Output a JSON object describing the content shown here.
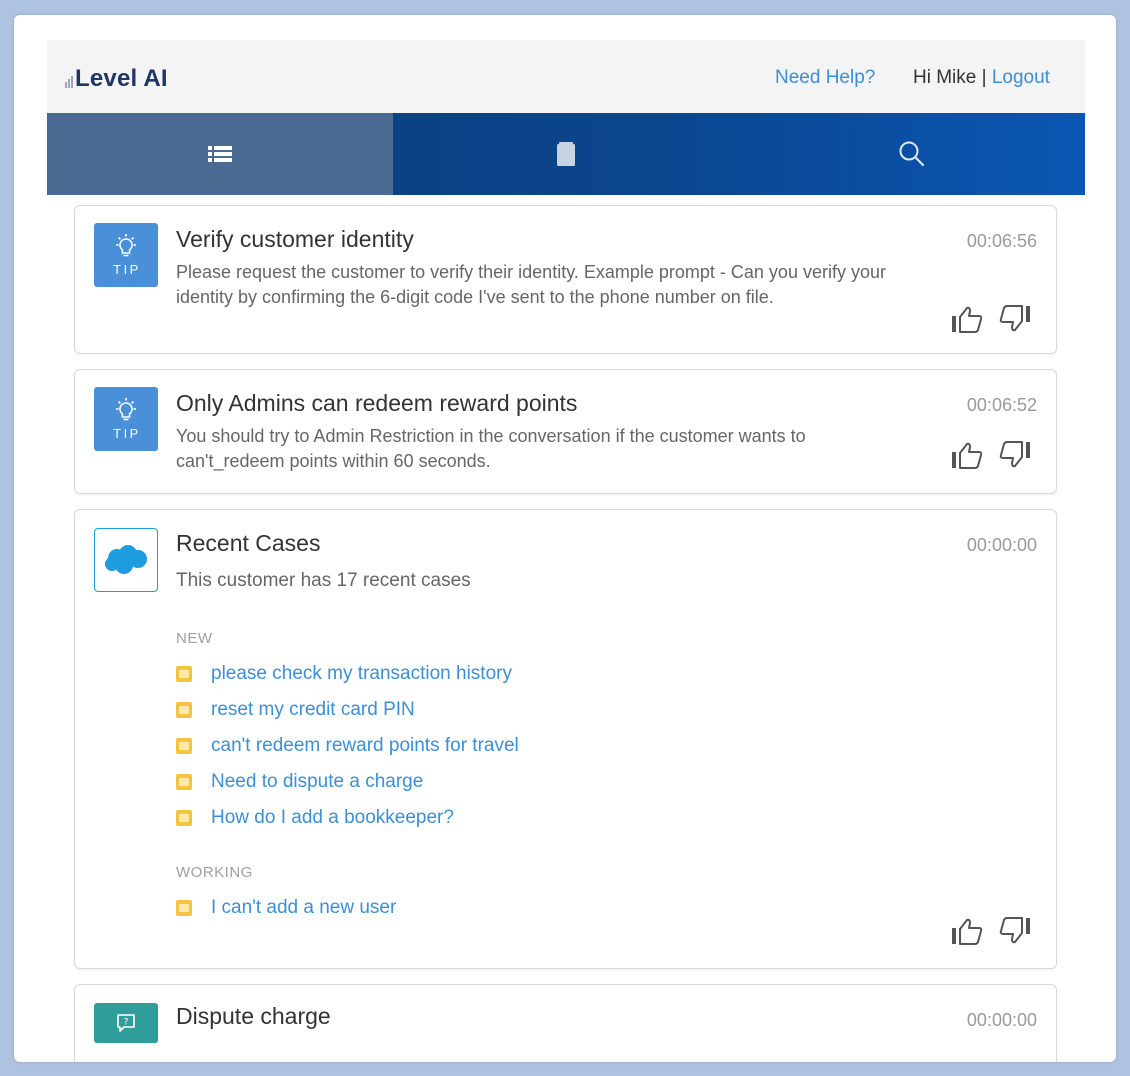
{
  "header": {
    "logo_text": "Level AI",
    "help_label": "Need Help?",
    "greeting": "Hi Mike",
    "separator": "|",
    "logout_label": "Logout"
  },
  "tabs": [
    {
      "icon": "list-icon",
      "active": true
    },
    {
      "icon": "book-icon",
      "active": false
    },
    {
      "icon": "search-icon",
      "active": false
    }
  ],
  "cards": [
    {
      "badge": "TIP",
      "title": "Verify customer identity",
      "time": "00:06:56",
      "body": "Please request the customer to verify their identity. Example prompt - Can you verify your identity by confirming the 6-digit code I've sent to the phone number on file."
    },
    {
      "badge": "TIP",
      "title": "Only Admins can redeem reward points",
      "time": "00:06:52",
      "body": "You should try to Admin Restriction in the conversation if the customer wants to can't_redeem points within 60 seconds."
    },
    {
      "title": "Recent Cases",
      "time": "00:00:00",
      "subtitle": "This customer has 17 recent cases",
      "sections": [
        {
          "label": "NEW",
          "items": [
            "please check my transaction history",
            "reset my credit card PIN",
            "can't redeem reward points for travel",
            "Need to dispute a charge",
            "How do I add a bookkeeper?"
          ]
        },
        {
          "label": "WORKING",
          "items": [
            "I can't add a new user"
          ]
        }
      ]
    },
    {
      "title": "Dispute charge",
      "time": "00:00:00"
    }
  ],
  "colors": {
    "accent": "#3b8fd6",
    "tip_badge": "#4a90d9",
    "case_icon": "#f5c342",
    "chat_badge": "#2f9e9a",
    "tabbar": "#0b468f"
  }
}
